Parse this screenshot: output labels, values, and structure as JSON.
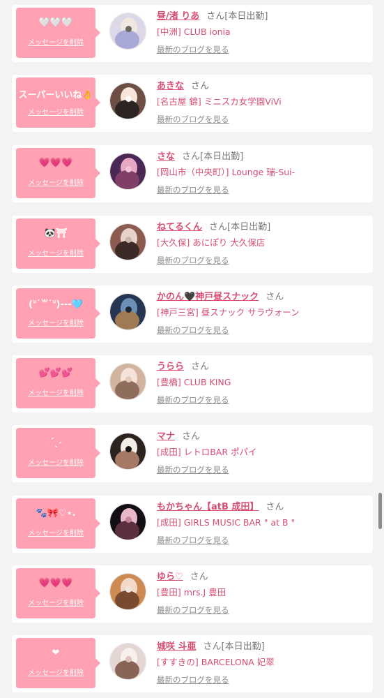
{
  "messages": [
    {
      "stamp": "🤍🤍🤍",
      "delete_label": "メッセージを削除",
      "name": "昼/渚 りあ",
      "suffix": "さん[本日出勤]",
      "shop": "[中洲] CLUB ionia",
      "blog_link": "最新のブログを見る",
      "avatar_colors": [
        "#dcd8e8",
        "#f1e7e1",
        "#a7a8d5",
        "#6b675d"
      ]
    },
    {
      "stamp": "スーパーいいね👌",
      "delete_label": "メッセージを削除",
      "name": "あきな",
      "suffix": "さん",
      "shop": "[名古屋 錦] ミニスカ女学園ViVi",
      "blog_link": "最新のブログを見る",
      "avatar_colors": [
        "#6d4e45",
        "#f6e5d8",
        "#2c2422",
        "#fafafa"
      ]
    },
    {
      "stamp": "💗💗💗",
      "delete_label": "メッセージを削除",
      "name": "さな",
      "suffix": "さん[本日出勤]",
      "shop": "[岡山市（中央町）] Lounge 瑞-Sui-",
      "blog_link": "最新のブログを見る",
      "avatar_colors": [
        "#4a2754",
        "#e6a8c2",
        "#7f3f66",
        "#f3c4d6"
      ]
    },
    {
      "stamp": "🐼⛩",
      "delete_label": "メッセージを削除",
      "name": "ねてるくん",
      "suffix": "さん[本日出勤]",
      "shop": "[大久保] あにぽり 大久保店",
      "blog_link": "最新のブログを見る",
      "avatar_colors": [
        "#8c5b4f",
        "#e8d3cb",
        "#3c2a26",
        "#cbb5a5"
      ]
    },
    {
      "stamp": "(ᐡ˙꒳˙ᐡ)---🩵",
      "delete_label": "メッセージを削除",
      "name": "かのん🖤神戸昼スナック",
      "suffix": "さん",
      "shop": "[神戸三宮] 昼スナック サラヴォーン",
      "blog_link": "最新のブログを見る",
      "avatar_colors": [
        "#263652",
        "#6b8fb5",
        "#9f7a53",
        "#1d2433"
      ]
    },
    {
      "stamp": "💕💕💕",
      "delete_label": "メッセージを削除",
      "name": "うらら",
      "suffix": "さん",
      "shop": "[豊橋] CLUB KING",
      "blog_link": "最新のブログを見る",
      "avatar_colors": [
        "#d2b39f",
        "#f5e2d9",
        "#8e6d5c",
        "#e3c8b8"
      ]
    },
    {
      "stamp": "ˊˎ˗",
      "delete_label": "メッセージを削除",
      "name": "マナ",
      "suffix": "さん",
      "shop": "[成田] レトロBAR ポパイ",
      "blog_link": "最新のブログを見る",
      "avatar_colors": [
        "#2a2320",
        "#f3ede7",
        "#a57965",
        "#191513"
      ]
    },
    {
      "stamp": "🐾🎀♡⋆.",
      "delete_label": "メッセージを削除",
      "name": "もかちゃん【atB 成田】",
      "suffix": "さん",
      "shop": "[成田] GIRLS MUSIC BAR \" at B \"",
      "blog_link": "最新のブログを見る",
      "avatar_colors": [
        "#130f14",
        "#e9b8c9",
        "#5b2f3e",
        "#c5859e"
      ]
    },
    {
      "stamp": "💗💗💗",
      "delete_label": "メッセージを削除",
      "name": "ゆら♡",
      "suffix": "さん",
      "shop": "[豊田] mrs.J 豊田",
      "blog_link": "最新のブログを見る",
      "avatar_colors": [
        "#cd8a53",
        "#f4d9cb",
        "#7a4a2f",
        "#eee5df"
      ]
    },
    {
      "stamp": "❤",
      "delete_label": "メッセージを削除",
      "name": "城咲 斗亜",
      "suffix": "さん[本日出勤]",
      "shop": "[すすきの] BARCELONA 妃翠",
      "blog_link": "最新のブログを見る",
      "avatar_colors": [
        "#e4d6d3",
        "#f8f0ed",
        "#8a6357",
        "#dcc2bb"
      ]
    }
  ],
  "colors": {
    "background": "#f3f3f3",
    "card": "#ffffff",
    "bubble": "#ffa1b2",
    "accent_text": "#d64e72",
    "muted_text": "#8c8c8c"
  }
}
